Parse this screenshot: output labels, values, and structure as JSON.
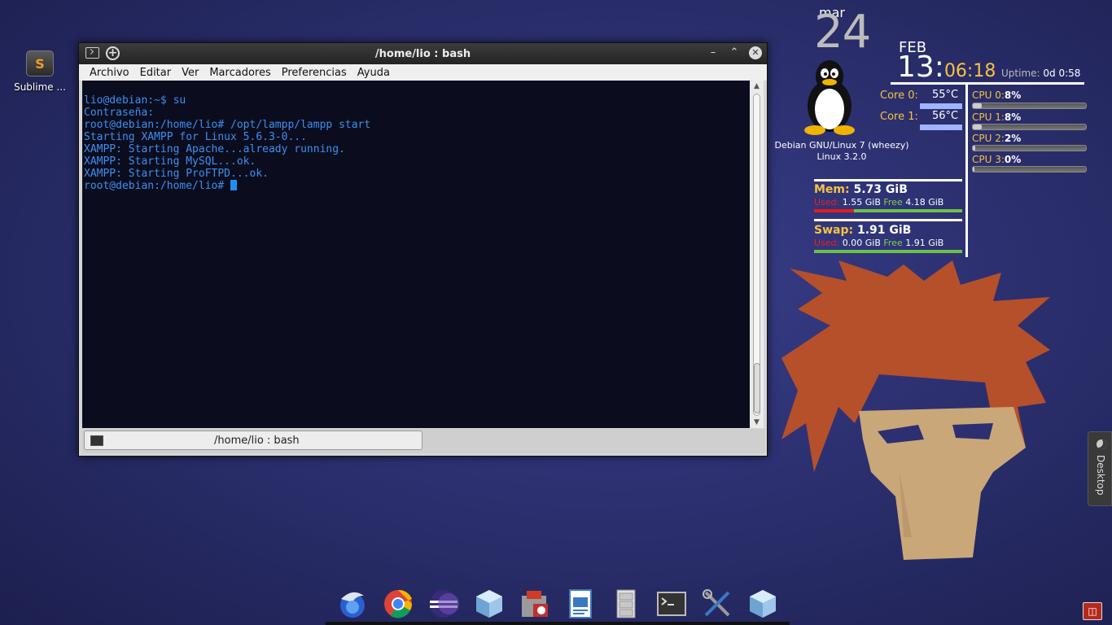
{
  "desktop": {
    "icons": [
      {
        "label": "Sublime ...",
        "icon": "sublime-text-icon",
        "glyph": "S"
      }
    ]
  },
  "terminal": {
    "title": "/home/lio : bash",
    "menu": [
      "Archivo",
      "Editar",
      "Ver",
      "Marcadores",
      "Preferencias",
      "Ayuda"
    ],
    "lines": [
      "lio@debian:~$ su",
      "Contraseña:",
      "root@debian:/home/lio# /opt/lampp/lampp start",
      "Starting XAMPP for Linux 5.6.3-0...",
      "XAMPP: Starting Apache...already running.",
      "XAMPP: Starting MySQL...ok.",
      "XAMPP: Starting ProFTPD...ok."
    ],
    "prompt": "root@debian:/home/lio# ",
    "tab_label": "/home/lio : bash",
    "colors": {
      "background": "#0b0d1e",
      "text": "#3c8ff0"
    }
  },
  "conky": {
    "day": "mar",
    "date": "24",
    "month": "FEB",
    "time_hour": "13:",
    "time_rest": "06:18",
    "uptime_label": "Uptime:",
    "uptime_value": "0d 0:58",
    "cores": [
      {
        "label": "Core 0:",
        "value": "55°C"
      },
      {
        "label": "Core 1:",
        "value": "56°C"
      }
    ],
    "os_line1": "Debian GNU/Linux 7 (wheezy)",
    "os_line2": "Linux 3.2.0",
    "cpus": [
      {
        "label": "CPU 0:",
        "value": "8%",
        "percent": 8
      },
      {
        "label": "CPU 1:",
        "value": "8%",
        "percent": 8
      },
      {
        "label": "CPU 2:",
        "value": "2%",
        "percent": 2
      },
      {
        "label": "CPU 3:",
        "value": "0%",
        "percent": 0
      }
    ],
    "mem": {
      "label": "Mem:",
      "total": "5.73 GiB",
      "used_label": "Used:",
      "used": "1.55 GiB",
      "free_label": "Free",
      "free": "4.18 GiB",
      "used_fraction": 0.27
    },
    "swap": {
      "label": "Swap:",
      "total": "1.91 GiB",
      "used_label": "Used:",
      "used": "0.00 GiB",
      "free_label": "Free",
      "free": "1.91 GiB",
      "used_fraction": 0.0
    },
    "accent": "#f5c342"
  },
  "side_tab": {
    "label": "Desktop"
  },
  "dock": [
    {
      "name": "dock-thunderbird-icon"
    },
    {
      "name": "dock-chrome-icon"
    },
    {
      "name": "dock-eclipse-icon"
    },
    {
      "name": "dock-virtualbox-icon"
    },
    {
      "name": "dock-software-center-icon"
    },
    {
      "name": "dock-writer-icon"
    },
    {
      "name": "dock-file-cabinet-icon"
    },
    {
      "name": "dock-terminal-icon"
    },
    {
      "name": "dock-settings-tools-icon"
    },
    {
      "name": "dock-virtualbox2-icon"
    }
  ],
  "corner_button": {
    "icon": "dropbox-like-icon"
  }
}
